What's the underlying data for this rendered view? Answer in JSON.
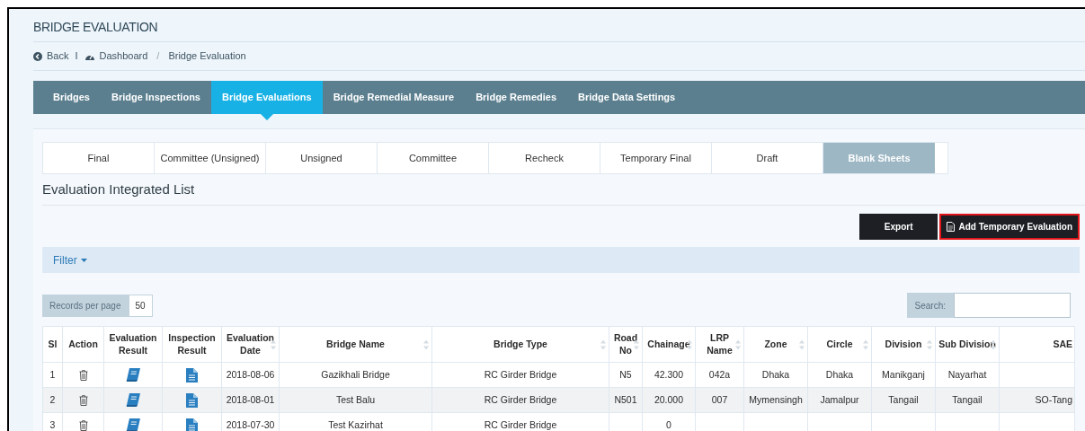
{
  "page_title": "BRIDGE EVALUATION",
  "breadcrumb": {
    "back": "Back",
    "separator": "I",
    "dashboard": "Dashboard",
    "divider": "/",
    "current": "Bridge Evaluation"
  },
  "nav_tabs": [
    {
      "label": "Bridges",
      "selected": false
    },
    {
      "label": "Bridge Inspections",
      "selected": false
    },
    {
      "label": "Bridge Evaluations",
      "selected": true
    },
    {
      "label": "Bridge Remedial Measure",
      "selected": false
    },
    {
      "label": "Bridge Remedies",
      "selected": false
    },
    {
      "label": "Bridge Data Settings",
      "selected": false
    }
  ],
  "sub_tabs": [
    {
      "label": "Final",
      "selected": false
    },
    {
      "label": "Committee (Unsigned)",
      "selected": false
    },
    {
      "label": "Unsigned",
      "selected": false
    },
    {
      "label": "Committee",
      "selected": false
    },
    {
      "label": "Recheck",
      "selected": false
    },
    {
      "label": "Temporary Final",
      "selected": false
    },
    {
      "label": "Draft",
      "selected": false
    },
    {
      "label": "Blank Sheets",
      "selected": true
    }
  ],
  "list_title": "Evaluation Integrated List",
  "buttons": [
    {
      "label": "Export",
      "kind": "plain",
      "highlighted": false
    },
    {
      "label": "Add Temporary Evaluation",
      "kind": "file",
      "highlighted": true
    }
  ],
  "filter": {
    "label": "Filter"
  },
  "records_per_page": {
    "label": "Records per page",
    "value": "50"
  },
  "search": {
    "label": "Search:"
  },
  "table": {
    "columns": [
      {
        "label": "Sl",
        "sortable": false
      },
      {
        "label": "Action",
        "sortable": false
      },
      {
        "label": "Evaluation Result",
        "sortable": false
      },
      {
        "label": "Inspection Result",
        "sortable": false
      },
      {
        "label": "Evaluation Date",
        "sortable": true
      },
      {
        "label": "Bridge Name",
        "sortable": true
      },
      {
        "label": "Bridge Type",
        "sortable": true
      },
      {
        "label": "Road No",
        "sortable": true
      },
      {
        "label": "Chainage",
        "sortable": true
      },
      {
        "label": "LRP Name",
        "sortable": true
      },
      {
        "label": "Zone",
        "sortable": true
      },
      {
        "label": "Circle",
        "sortable": true
      },
      {
        "label": "Division",
        "sortable": true
      },
      {
        "label": "Sub Division",
        "sortable": true
      },
      {
        "label": "SAE",
        "sortable": false
      }
    ],
    "rows": [
      {
        "sl": "1",
        "date": "2018-08-06",
        "bridge_name": "Gazikhali Bridge",
        "bridge_type": "RC Girder Bridge",
        "road_no": "N5",
        "chainage": "42.300",
        "lrp_name": "042a",
        "zone": "Dhaka",
        "circle": "Dhaka",
        "division": "Manikganj",
        "sub_division": "Nayarhat"
      },
      {
        "sl": "2",
        "date": "2018-08-01",
        "bridge_name": "Test Balu",
        "bridge_type": "RC Girder Bridge",
        "road_no": "N501",
        "chainage": "20.000",
        "lrp_name": "007",
        "zone": "Mymensingh",
        "circle": "Jamalpur",
        "division": "Tangail",
        "sub_division": "Tangail",
        "sae": "SO-Tang"
      },
      {
        "sl": "3",
        "date": "2018-07-30",
        "bridge_name": "Test Kazirhat",
        "bridge_type": "RC Girder Bridge",
        "chainage": "0"
      }
    ]
  }
}
